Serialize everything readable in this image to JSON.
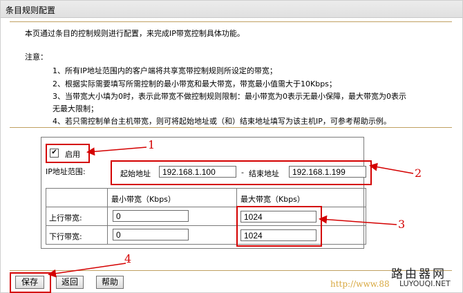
{
  "window": {
    "title": "条目规则配置"
  },
  "description": "本页通过条目的控制规则进行配置，来完成IP带宽控制具体功能。",
  "notes": {
    "heading": "注意：",
    "items": [
      "1、所有IP地址范围内的客户端将共享宽带控制规则所设定的带宽；",
      "2、根据实际需要填写所需控制的最小带宽和最大带宽，带宽最小值需大于10Kbps；",
      "3、当带宽大小填为0时，表示此带宽不做控制规则限制：最小带宽为0表示无最小保障，最大带宽为0表示",
      "无最大限制；",
      "4、若只需控制单台主机带宽，则可将起始地址或（和）结束地址填写为该主机IP，可参考帮助示例。"
    ]
  },
  "form": {
    "enable_label": "启用",
    "enable_checked": true,
    "ip_range_label": "IP地址范围:",
    "start_label": "起始地址",
    "start_value": "192.168.1.100",
    "dash": "-",
    "end_label": "结束地址",
    "end_value": "192.168.1.199",
    "table": {
      "col_min": "最小带宽（Kbps）",
      "col_max": "最大带宽（Kbps）",
      "rows": [
        {
          "label": "上行带宽:",
          "min": "0",
          "max": "1024"
        },
        {
          "label": "下行带宽:",
          "min": "0",
          "max": "1024"
        }
      ]
    }
  },
  "buttons": {
    "save": "保存",
    "back": "返回",
    "help": "帮助"
  },
  "annotations": [
    "1",
    "2",
    "3",
    "4"
  ],
  "watermark": {
    "brand": "路由器网",
    "url": "http://www.88",
    "site": "LUYOUQI.NET"
  },
  "colors": {
    "annotation": "#d40000",
    "separator": "#c0a060",
    "titlebar": "#e4e4e4"
  }
}
